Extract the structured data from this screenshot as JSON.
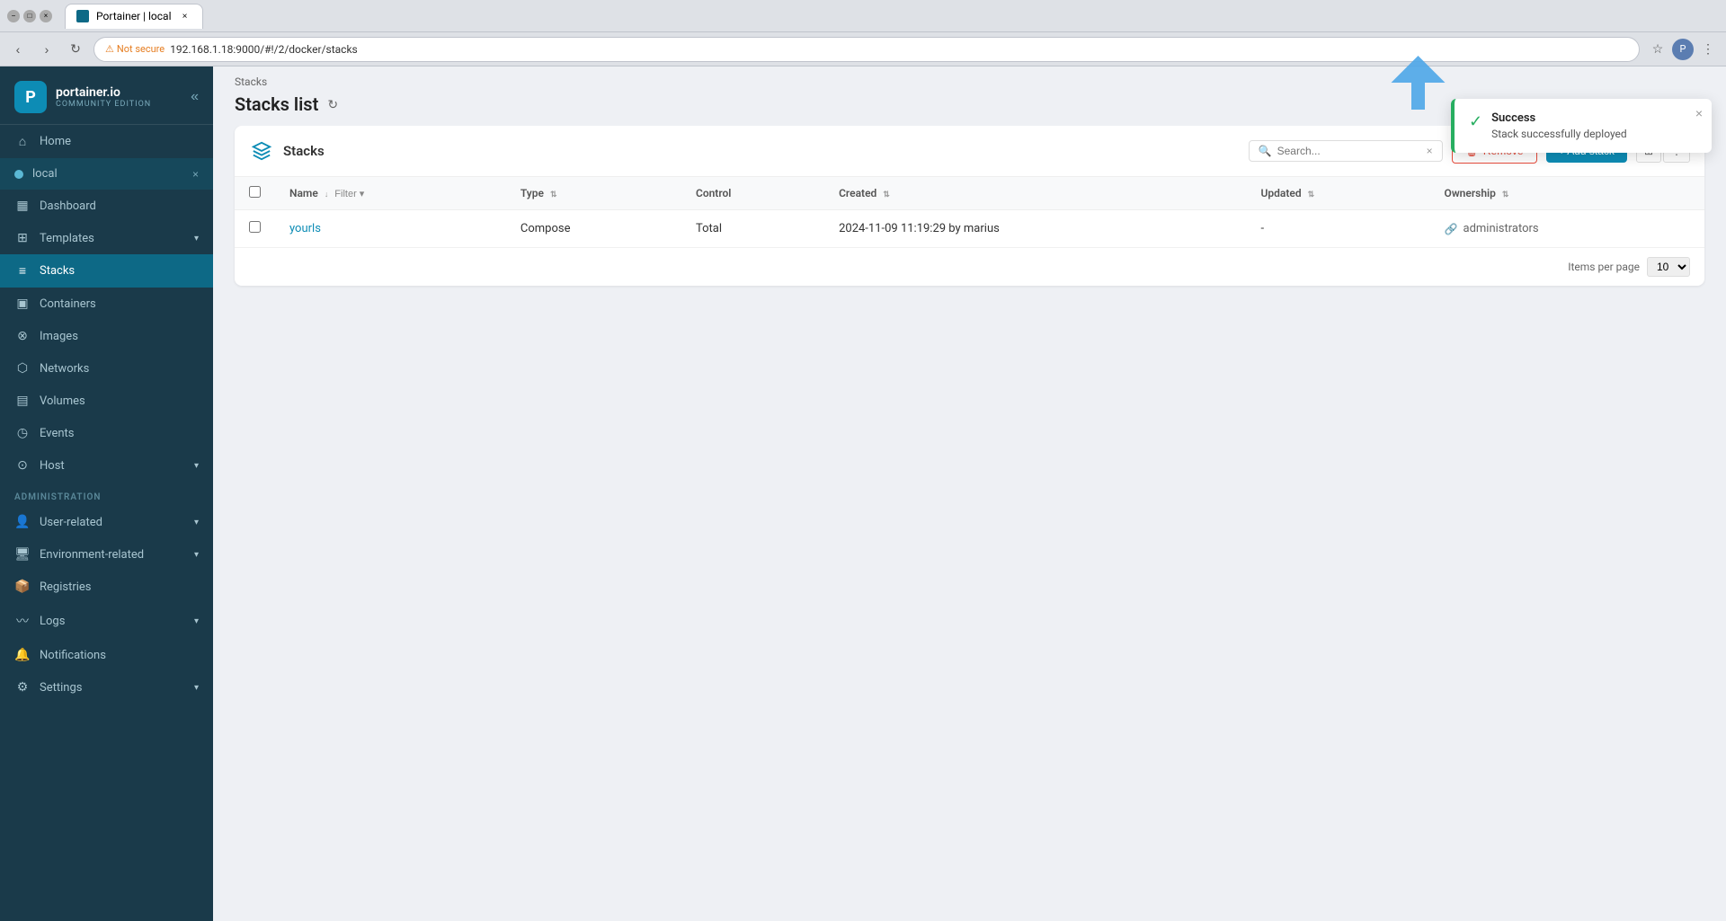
{
  "browser": {
    "tab_title": "Portainer | local",
    "address": "192.168.1.18:9000/#!/2/docker/stacks",
    "not_secure_label": "Not secure"
  },
  "sidebar": {
    "logo_name": "portainer.io",
    "logo_sub": "Community Edition",
    "nav_items": [
      {
        "id": "home",
        "label": "Home",
        "icon": "⌂"
      },
      {
        "id": "local",
        "label": "local",
        "icon": "●",
        "is_env": true
      },
      {
        "id": "dashboard",
        "label": "Dashboard",
        "icon": "▦"
      },
      {
        "id": "templates",
        "label": "Templates",
        "icon": "⊞",
        "has_chevron": true
      },
      {
        "id": "stacks",
        "label": "Stacks",
        "icon": "≡",
        "active": true
      },
      {
        "id": "containers",
        "label": "Containers",
        "icon": "▣"
      },
      {
        "id": "images",
        "label": "Images",
        "icon": "⊗"
      },
      {
        "id": "networks",
        "label": "Networks",
        "icon": "⬡"
      },
      {
        "id": "volumes",
        "label": "Volumes",
        "icon": "▤"
      },
      {
        "id": "events",
        "label": "Events",
        "icon": "◷"
      },
      {
        "id": "host",
        "label": "Host",
        "icon": "⊙",
        "has_chevron": true
      }
    ],
    "admin_section": "Administration",
    "admin_items": [
      {
        "id": "user-related",
        "label": "User-related",
        "icon": "👤",
        "has_chevron": true
      },
      {
        "id": "environment-related",
        "label": "Environment-related",
        "icon": "🖥",
        "has_chevron": true
      },
      {
        "id": "registries",
        "label": "Registries",
        "icon": "📦"
      },
      {
        "id": "logs",
        "label": "Logs",
        "icon": "〰",
        "has_chevron": true
      },
      {
        "id": "notifications",
        "label": "Notifications",
        "icon": "🔔"
      },
      {
        "id": "settings",
        "label": "Settings",
        "icon": "⚙",
        "has_chevron": true
      }
    ]
  },
  "breadcrumb": "Stacks",
  "page_title": "Stacks list",
  "card": {
    "title": "Stacks",
    "search_placeholder": "Search...",
    "remove_label": "Remove",
    "add_stack_label": "+ Add stack",
    "items_per_page_label": "Items per page",
    "items_per_page_value": "10"
  },
  "table": {
    "columns": [
      {
        "key": "name",
        "label": "Name",
        "sortable": true,
        "filterable": true
      },
      {
        "key": "type",
        "label": "Type",
        "sortable": true
      },
      {
        "key": "control",
        "label": "Control"
      },
      {
        "key": "created",
        "label": "Created",
        "sortable": true
      },
      {
        "key": "updated",
        "label": "Updated",
        "sortable": true
      },
      {
        "key": "ownership",
        "label": "Ownership",
        "sortable": true
      }
    ],
    "rows": [
      {
        "id": 1,
        "name": "yourls",
        "type": "Compose",
        "control": "Total",
        "created": "2024-11-09 11:19:29 by marius",
        "updated": "-",
        "ownership": "administrators"
      }
    ]
  },
  "toast": {
    "title": "Success",
    "message": "Stack successfully deployed",
    "close_label": "×"
  }
}
